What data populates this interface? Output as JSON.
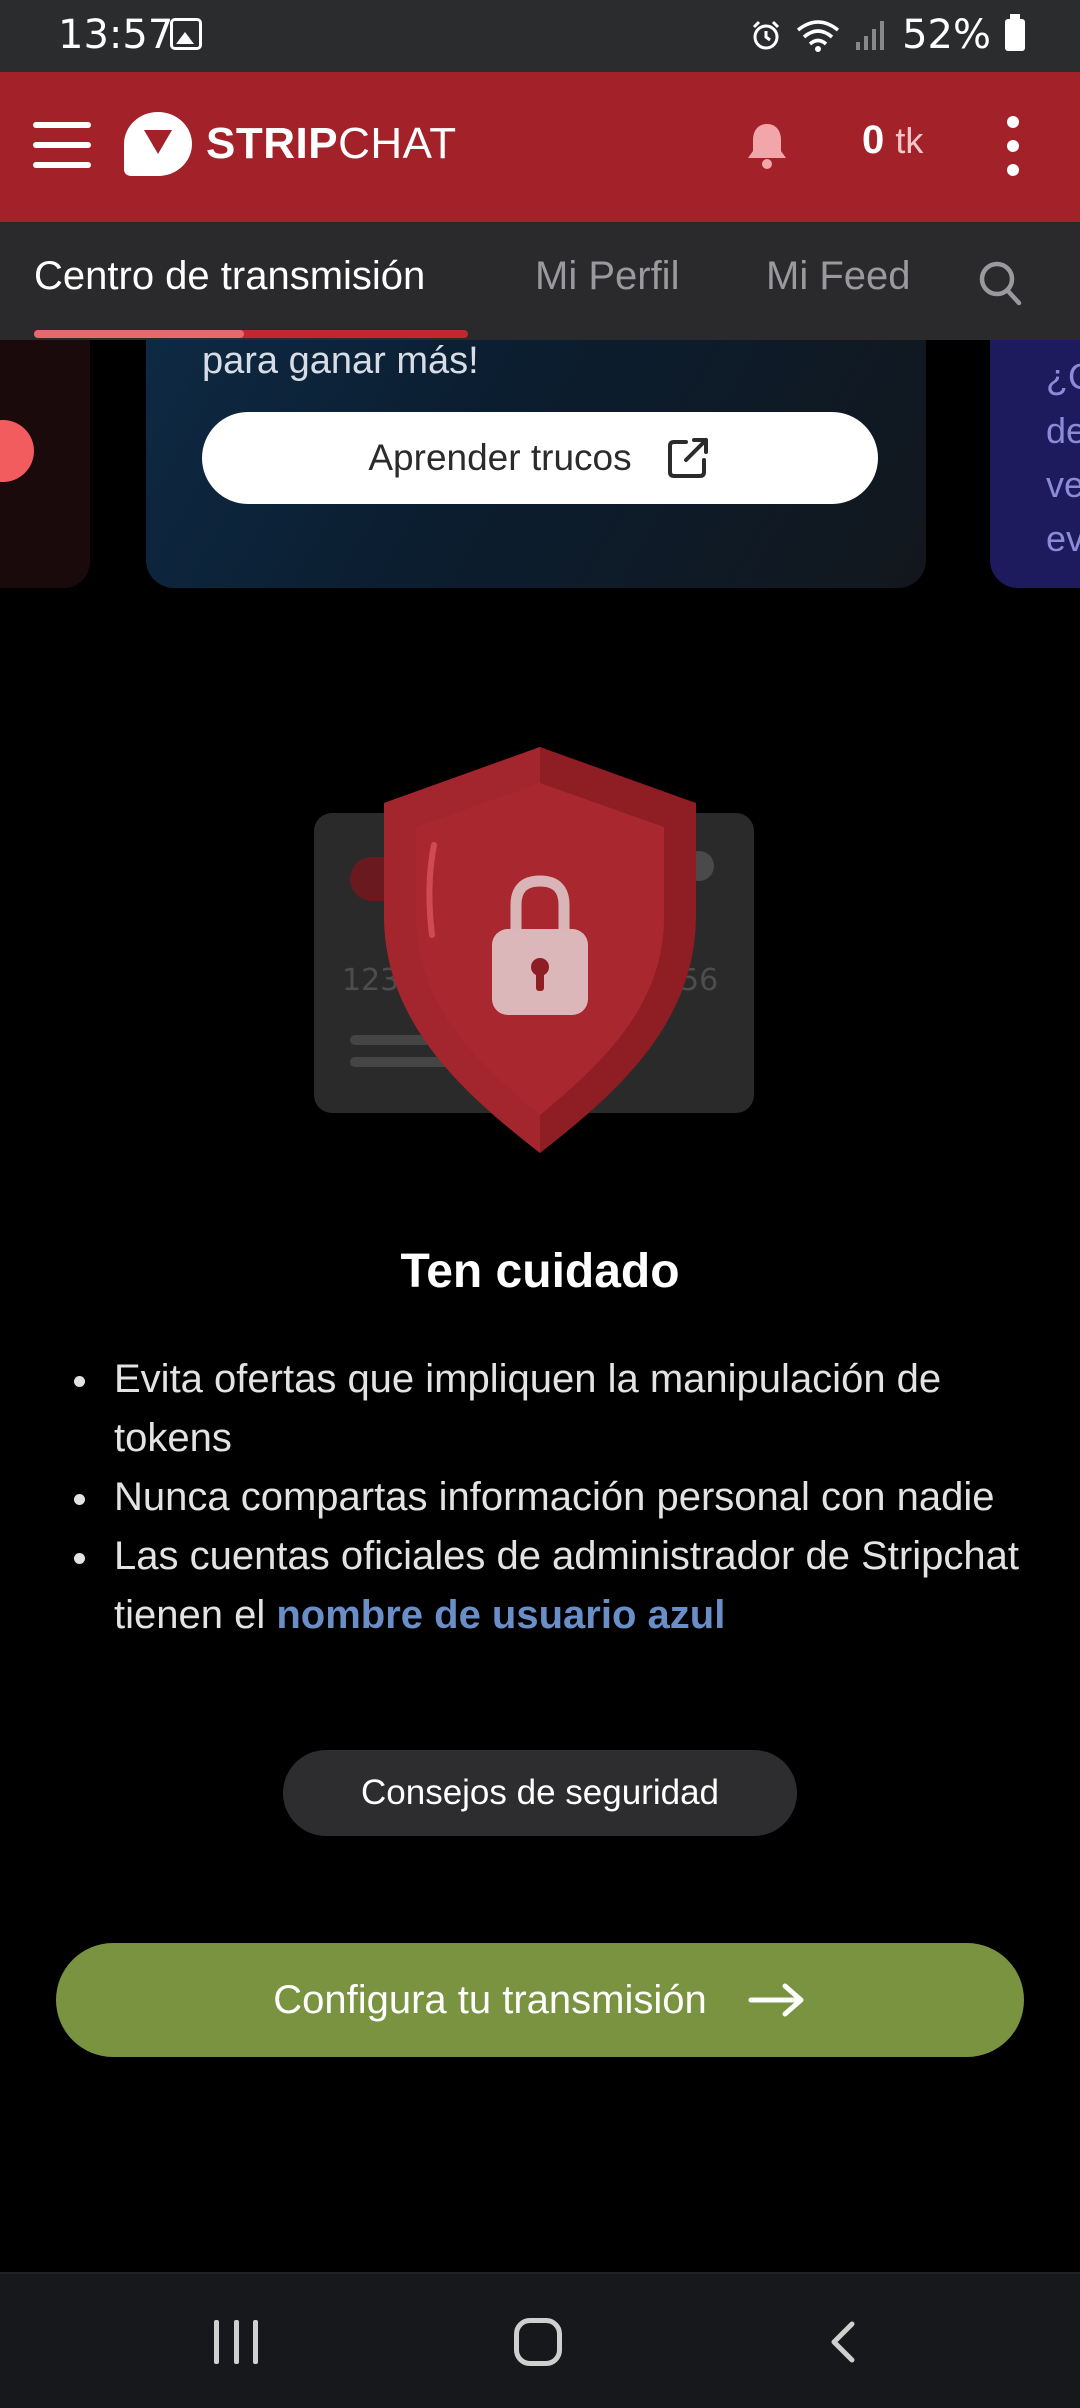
{
  "status_bar": {
    "time": "13:57",
    "battery": "52%",
    "icons": [
      "image-icon",
      "alarm-icon",
      "wifi-icon",
      "signal-icon",
      "battery-icon"
    ]
  },
  "header": {
    "logo_bold": "STRIP",
    "logo_light": "CHAT",
    "tokens_value": "0",
    "tokens_unit": "tk",
    "brand_color": "#a32129"
  },
  "tabs": [
    {
      "label": "Centro de transmisión",
      "active": true
    },
    {
      "label": "Mi Perfil",
      "active": false
    },
    {
      "label": "Mi Feed",
      "active": false
    }
  ],
  "carousel": {
    "mid_text": "para ganar más!",
    "learn_button": "Aprender trucos",
    "right_text": "¿C\nde\nve\nev"
  },
  "illustration": {
    "card_left_digits": "123",
    "card_right_digits": "56"
  },
  "warning": {
    "title": "Ten cuidado",
    "items": [
      "Evita ofertas que impliquen la manipulación de tokens",
      "Nunca compartas información personal con nadie"
    ],
    "item3_prefix": "Las cuentas oficiales de administrador de Stripchat tienen el ",
    "item3_link": "nombre de usuario azul"
  },
  "safety_button": "Consejos de seguridad",
  "setup_button": "Configura tu transmisión",
  "colors": {
    "accent_green": "#7a9340",
    "link_blue": "#6a8fc8"
  }
}
